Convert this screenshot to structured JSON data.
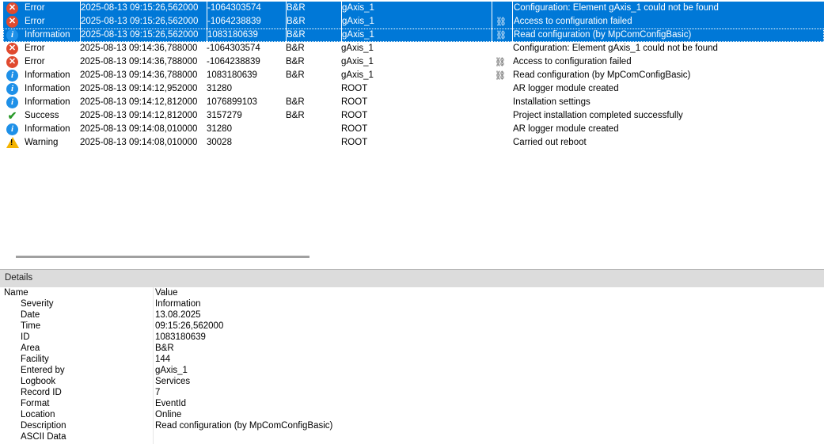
{
  "log": {
    "rows": [
      {
        "severity": "Error",
        "icon": "error-icon",
        "time": "2025-08-13 09:15:26,562000",
        "id": "-1064303574",
        "area": "B&R",
        "facility": "gAxis_1",
        "link": false,
        "description": "Configuration: Element gAxis_1 could not be found",
        "selected": true
      },
      {
        "severity": "Error",
        "icon": "error-icon",
        "time": "2025-08-13 09:15:26,562000",
        "id": "-1064238839",
        "area": "B&R",
        "facility": "gAxis_1",
        "link": true,
        "description": "Access to configuration failed",
        "selected": true
      },
      {
        "severity": "Information",
        "icon": "info-icon",
        "time": "2025-08-13 09:15:26,562000",
        "id": "1083180639",
        "area": "B&R",
        "facility": "gAxis_1",
        "link": true,
        "description": "Read configuration (by MpComConfigBasic)",
        "selected": true,
        "focused": true
      },
      {
        "severity": "Error",
        "icon": "error-icon",
        "time": "2025-08-13 09:14:36,788000",
        "id": "-1064303574",
        "area": "B&R",
        "facility": "gAxis_1",
        "link": false,
        "description": "Configuration: Element gAxis_1 could not be found"
      },
      {
        "severity": "Error",
        "icon": "error-icon",
        "time": "2025-08-13 09:14:36,788000",
        "id": "-1064238839",
        "area": "B&R",
        "facility": "gAxis_1",
        "link": true,
        "description": "Access to configuration failed"
      },
      {
        "severity": "Information",
        "icon": "info-icon",
        "time": "2025-08-13 09:14:36,788000",
        "id": "1083180639",
        "area": "B&R",
        "facility": "gAxis_1",
        "link": true,
        "description": "Read configuration (by MpComConfigBasic)"
      },
      {
        "severity": "Information",
        "icon": "info-icon",
        "time": "2025-08-13 09:14:12,952000",
        "id": "31280",
        "area": "",
        "facility": "ROOT",
        "link": false,
        "description": "AR logger module created"
      },
      {
        "severity": "Information",
        "icon": "info-icon",
        "time": "2025-08-13 09:14:12,812000",
        "id": "1076899103",
        "area": "B&R",
        "facility": "ROOT",
        "link": false,
        "description": "Installation settings"
      },
      {
        "severity": "Success",
        "icon": "success-icon",
        "time": "2025-08-13 09:14:12,812000",
        "id": "3157279",
        "area": "B&R",
        "facility": "ROOT",
        "link": false,
        "description": "Project installation completed successfully"
      },
      {
        "severity": "Information",
        "icon": "info-icon",
        "time": "2025-08-13 09:14:08,010000",
        "id": "31280",
        "area": "",
        "facility": "ROOT",
        "link": false,
        "description": "AR logger module created"
      },
      {
        "severity": "Warning",
        "icon": "warning-icon",
        "time": "2025-08-13 09:14:08,010000",
        "id": "30028",
        "area": "",
        "facility": "ROOT",
        "link": false,
        "description": "Carried out reboot"
      }
    ]
  },
  "details": {
    "title": "Details",
    "name_header": "Name",
    "value_header": "Value",
    "fields": [
      {
        "name": "Severity",
        "value": "Information"
      },
      {
        "name": "Date",
        "value": "13.08.2025"
      },
      {
        "name": "Time",
        "value": "09:15:26,562000"
      },
      {
        "name": "ID",
        "value": "1083180639"
      },
      {
        "name": "Area",
        "value": "B&R"
      },
      {
        "name": "Facility",
        "value": "144"
      },
      {
        "name": "Entered by",
        "value": "gAxis_1"
      },
      {
        "name": "Logbook",
        "value": "Services"
      },
      {
        "name": "Record ID",
        "value": "7"
      },
      {
        "name": "Format",
        "value": "EventId"
      },
      {
        "name": "Location",
        "value": "Online"
      },
      {
        "name": "Description",
        "value": "Read configuration (by MpComConfigBasic)"
      },
      {
        "name": "ASCII Data",
        "value": ""
      }
    ]
  },
  "colors": {
    "selection": "#0078d7",
    "error": "#e04a2f",
    "info": "#1e90e8",
    "success": "#2a9a2a",
    "warning": "#f5b400"
  }
}
